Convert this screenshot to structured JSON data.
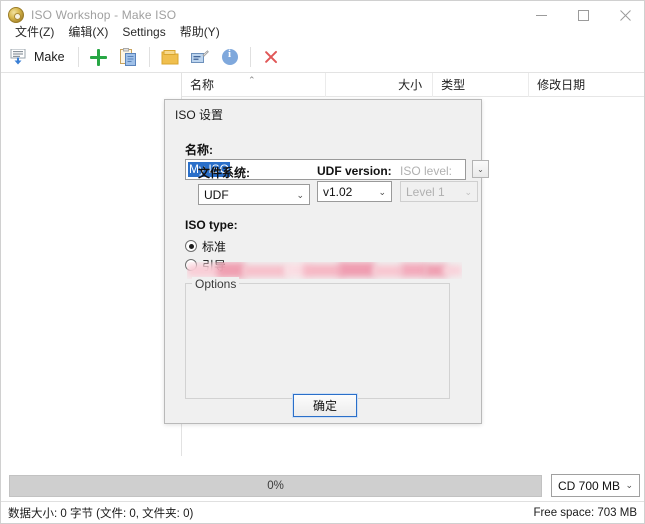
{
  "window": {
    "title": "ISO Workshop - Make ISO",
    "app_icon": "disc-icon",
    "controls": {
      "minimize": "minimize-icon",
      "maximize": "maximize-icon",
      "close": "close-icon"
    }
  },
  "menubar": {
    "items": [
      {
        "label": "文件(Z)"
      },
      {
        "label": "编辑(X)"
      },
      {
        "label": "Settings"
      },
      {
        "label": "帮助(Y)"
      }
    ]
  },
  "toolbar": {
    "make_label": "Make",
    "make_icon": "make-iso-icon",
    "buttons": [
      {
        "icon": "plus-icon"
      },
      {
        "icon": "paste-clipboard-icon"
      },
      {
        "icon": "folder-icon"
      },
      {
        "icon": "rename-icon"
      },
      {
        "icon": "info-icon"
      },
      {
        "icon": "delete-x-icon"
      }
    ]
  },
  "filelist": {
    "columns": [
      {
        "label": "名称",
        "sort_caret": "⌃"
      },
      {
        "label": "大小"
      },
      {
        "label": "类型"
      },
      {
        "label": "修改日期"
      }
    ]
  },
  "dialog": {
    "title": "ISO 设置",
    "name": {
      "label": "名称:",
      "value": "My ISO",
      "selected": true,
      "dropdown_icon": "chevron-down-icon"
    },
    "iso_type": {
      "label": "ISO type:",
      "options": [
        {
          "label": "标准",
          "checked": true
        },
        {
          "label": "引导",
          "checked": false
        }
      ],
      "redacted": true
    },
    "options_group": {
      "title": "Options",
      "fields": [
        {
          "label": "文件系统:",
          "value": "UDF",
          "disabled": false,
          "caret": "⌄"
        },
        {
          "label": "UDF version:",
          "value": "v1.02",
          "disabled": false,
          "caret": "⌄"
        },
        {
          "label": "ISO level:",
          "value": "Level 1",
          "disabled": true,
          "caret": "⌄"
        }
      ]
    },
    "ok_button": "确定"
  },
  "bottom": {
    "progress_text": "0%",
    "progress_percent": 0,
    "media": {
      "value": "CD 700 MB",
      "caret": "⌄"
    }
  },
  "statusbar": {
    "left": "数据大小: 0 字节 (文件: 0, 文件夹: 0)",
    "right": "Free space: 703 MB"
  },
  "colors": {
    "selection_blue": "#2a6fc9",
    "accent_green": "#28a745",
    "redaction_pink": "#f4a7b5",
    "progress_track": "#cfcfcf",
    "dialog_bg": "#f0f0f0"
  }
}
